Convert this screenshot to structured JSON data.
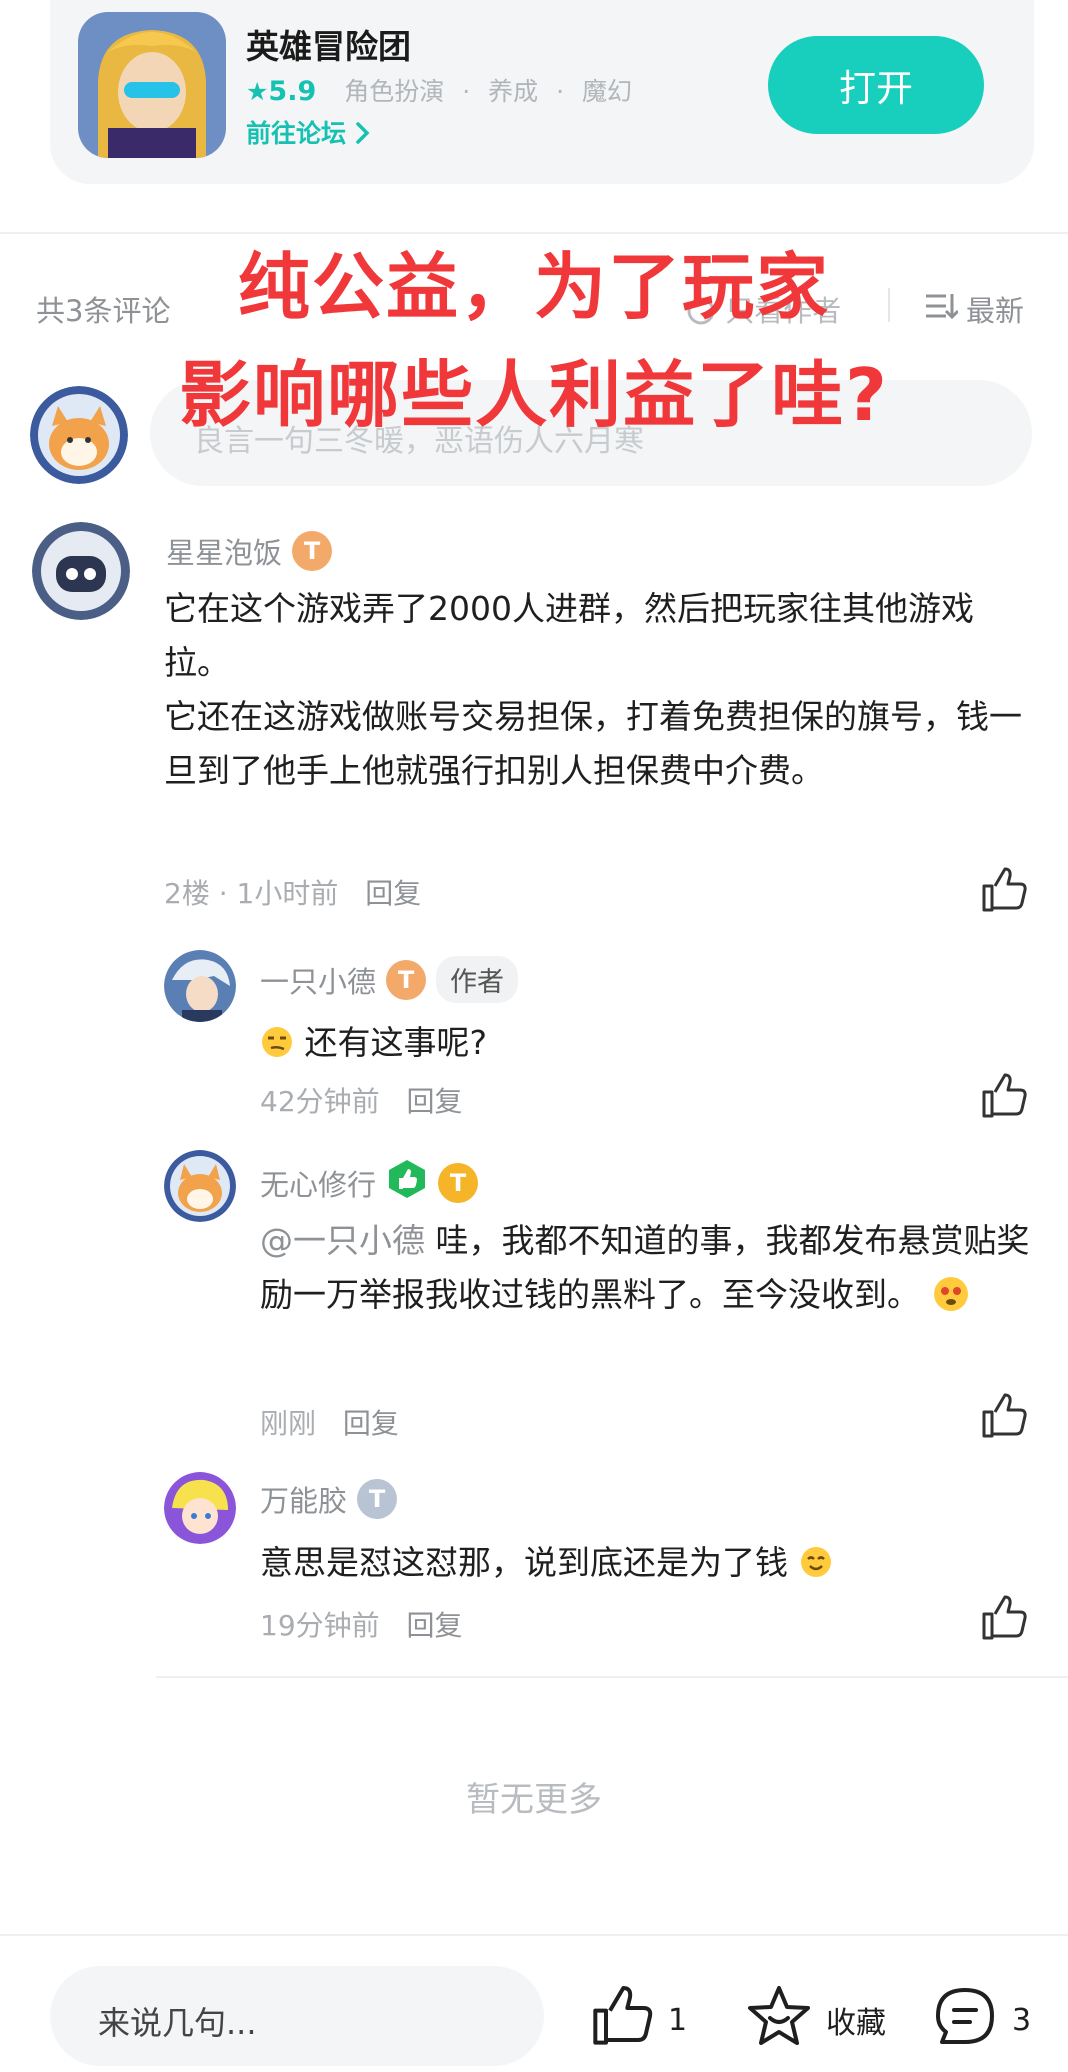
{
  "app": {
    "name": "英雄冒险团",
    "rating": "5.9",
    "tags": [
      "角色扮演",
      "养成",
      "魔幻"
    ],
    "forum_link": "前往论坛",
    "open_label": "打开"
  },
  "comments_header": {
    "count_label": "共3条评论",
    "sort_hot": "只看作者",
    "sort_new": "最新"
  },
  "overlay": {
    "line1": "纯公益，为了玩家",
    "line2": "影响哪些人利益了哇?"
  },
  "top_input": {
    "placeholder": "良言一句三冬暖，恶语伤人六月寒"
  },
  "main_comment": {
    "user": "星星泡饭",
    "level": "T",
    "paragraphs": [
      "它在这个游戏弄了2000人进群，然后把玩家往其他游戏拉。",
      "它还在这游戏做账号交易担保，打着免费担保的旗号，钱一旦到了他手上他就强行扣别人担保费中介费。"
    ],
    "floor": "2楼",
    "time": "1小时前",
    "reply": "回复"
  },
  "replies": [
    {
      "user": "一只小德",
      "level": "T",
      "tag": "作者",
      "text": "还有这事呢?",
      "time": "42分钟前",
      "reply": "回复",
      "badge_color": "#f2a96a"
    },
    {
      "user": "无心修行",
      "level": "T",
      "mention": "@一只小德",
      "text": "哇，我都不知道的事，我都发布悬赏贴奖励一万举报我收过钱的黑料了。至今没收到。",
      "time": "刚刚",
      "reply": "回复",
      "badge_color": "#f6b428"
    },
    {
      "user": "万能胶",
      "level": "T",
      "text": "意思是怼这怼那，说到底还是为了钱",
      "time": "19分钟前",
      "reply": "回复",
      "badge_color": "#b8c4d4"
    }
  ],
  "footer": {
    "no_more": "暂无更多",
    "input_placeholder": "来说几句...",
    "like_count": "1",
    "fav_label": "收藏",
    "comment_count": "3"
  },
  "colors": {
    "accent": "#17cfbc",
    "overlay_red": "#f0383a"
  }
}
